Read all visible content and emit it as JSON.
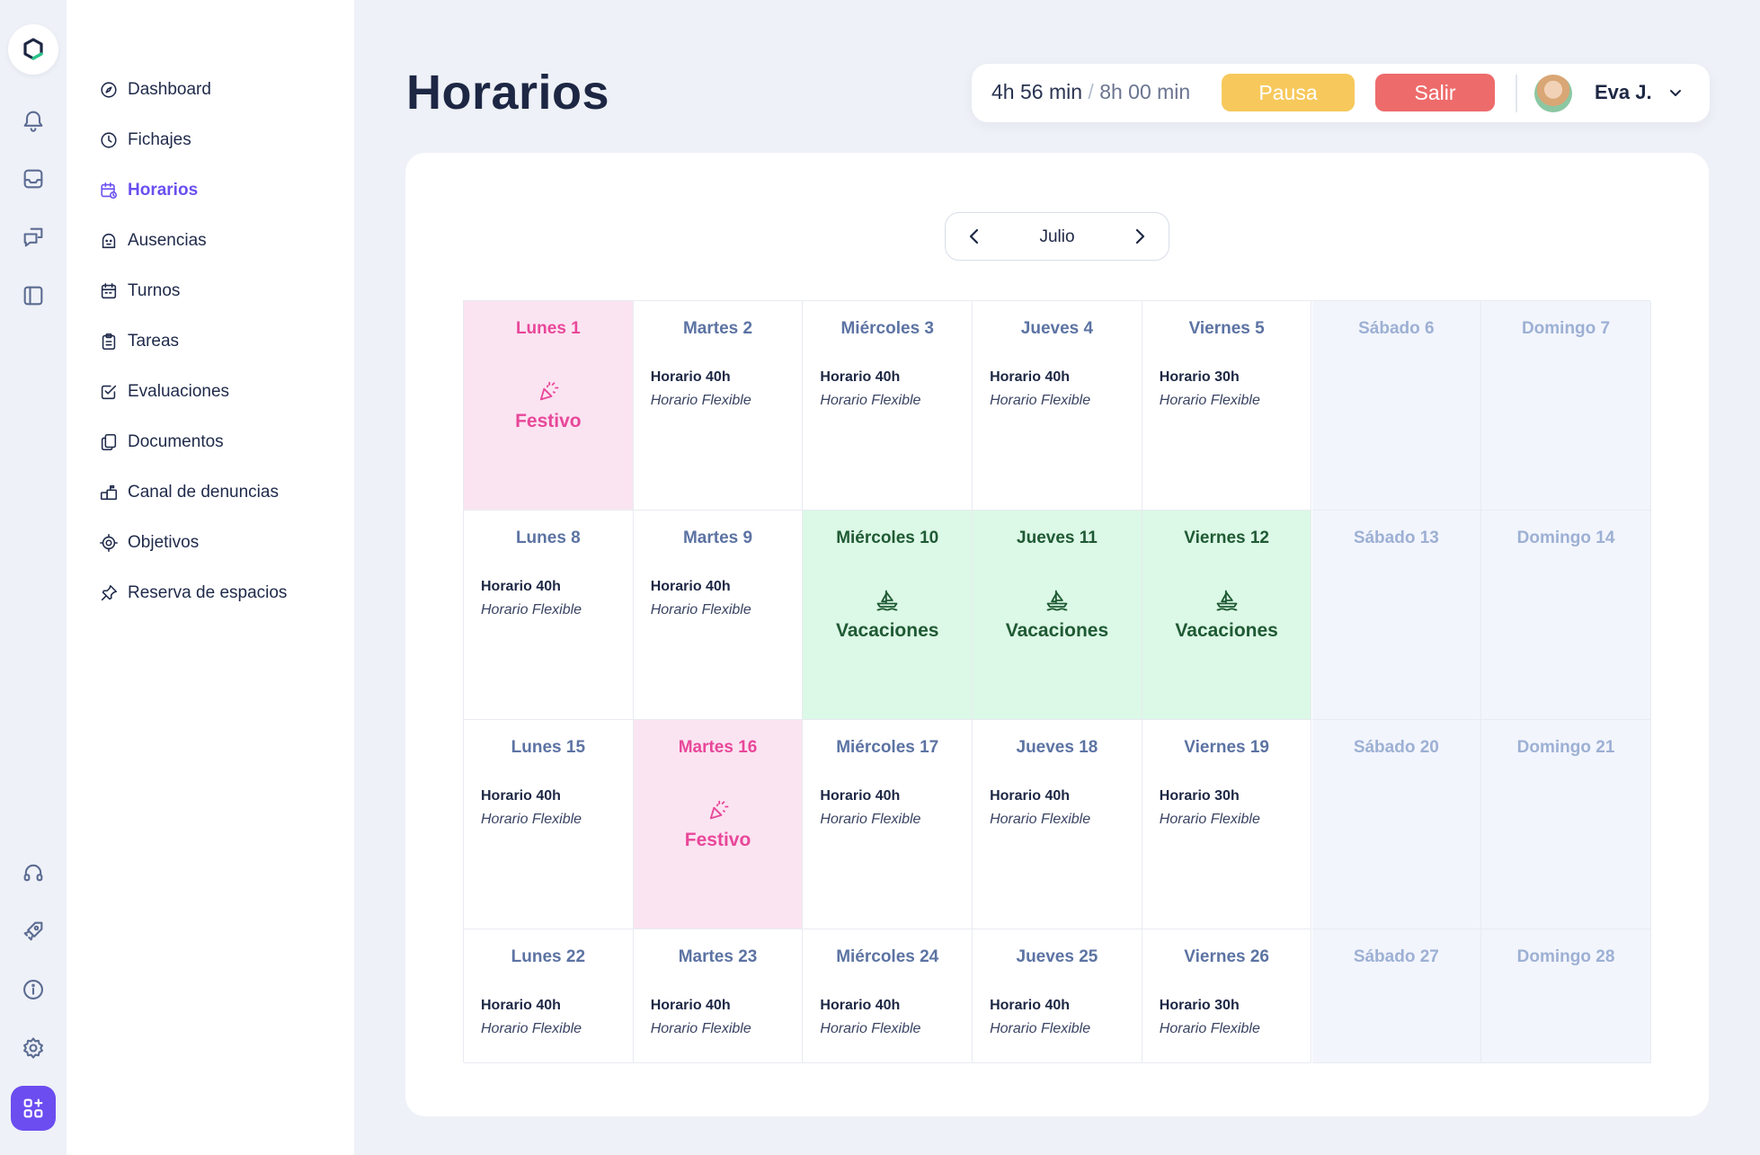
{
  "rail": {
    "icons": [
      "logo-icon",
      "bell-icon",
      "inbox-icon",
      "chat-icon",
      "sidebar-icon",
      "headset-icon",
      "rocket-icon",
      "info-icon",
      "gear-icon",
      "apps-grid-icon"
    ]
  },
  "sidebar": {
    "items": [
      {
        "label": "Dashboard",
        "icon": "compass-icon"
      },
      {
        "label": "Fichajes",
        "icon": "clock-icon"
      },
      {
        "label": "Horarios",
        "icon": "calendar-clock-icon",
        "active": true
      },
      {
        "label": "Ausencias",
        "icon": "face-icon"
      },
      {
        "label": "Turnos",
        "icon": "calendar-icon"
      },
      {
        "label": "Tareas",
        "icon": "clipboard-icon"
      },
      {
        "label": "Evaluaciones",
        "icon": "check-square-icon"
      },
      {
        "label": "Documentos",
        "icon": "documents-icon"
      },
      {
        "label": "Canal de denuncias",
        "icon": "mailbox-icon"
      },
      {
        "label": "Objetivos",
        "icon": "target-icon"
      },
      {
        "label": "Reserva de espacios",
        "icon": "pin-icon"
      }
    ]
  },
  "header": {
    "title": "Horarios",
    "timer": {
      "worked": "4h 56 min",
      "separator": "/",
      "total": "8h 00 min"
    },
    "pause_label": "Pausa",
    "exit_label": "Salir",
    "user_name": "Eva J."
  },
  "calendar": {
    "month": "Julio",
    "weeks": [
      [
        {
          "day": "Lunes 1",
          "kind": "holiday",
          "event": "Festivo"
        },
        {
          "day": "Martes 2",
          "kind": "work",
          "title": "Horario 40h",
          "type": "Horario Flexible"
        },
        {
          "day": "Miércoles 3",
          "kind": "work",
          "title": "Horario 40h",
          "type": "Horario Flexible"
        },
        {
          "day": "Jueves 4",
          "kind": "work",
          "title": "Horario 40h",
          "type": "Horario Flexible"
        },
        {
          "day": "Viernes 5",
          "kind": "work",
          "title": "Horario 30h",
          "type": "Horario Flexible"
        },
        {
          "day": "Sábado 6",
          "kind": "weekend"
        },
        {
          "day": "Domingo 7",
          "kind": "weekend"
        }
      ],
      [
        {
          "day": "Lunes 8",
          "kind": "work",
          "title": "Horario 40h",
          "type": "Horario Flexible"
        },
        {
          "day": "Martes 9",
          "kind": "work",
          "title": "Horario 40h",
          "type": "Horario Flexible"
        },
        {
          "day": "Miércoles 10",
          "kind": "vacation",
          "event": "Vacaciones"
        },
        {
          "day": "Jueves 11",
          "kind": "vacation",
          "event": "Vacaciones"
        },
        {
          "day": "Viernes 12",
          "kind": "vacation",
          "event": "Vacaciones"
        },
        {
          "day": "Sábado 13",
          "kind": "weekend"
        },
        {
          "day": "Domingo 14",
          "kind": "weekend"
        }
      ],
      [
        {
          "day": "Lunes 15",
          "kind": "work",
          "title": "Horario 40h",
          "type": "Horario Flexible"
        },
        {
          "day": "Martes 16",
          "kind": "holiday",
          "event": "Festivo"
        },
        {
          "day": "Miércoles 17",
          "kind": "work",
          "title": "Horario 40h",
          "type": "Horario Flexible"
        },
        {
          "day": "Jueves 18",
          "kind": "work",
          "title": "Horario 40h",
          "type": "Horario Flexible"
        },
        {
          "day": "Viernes 19",
          "kind": "work",
          "title": "Horario 30h",
          "type": "Horario Flexible"
        },
        {
          "day": "Sábado 20",
          "kind": "weekend"
        },
        {
          "day": "Domingo 21",
          "kind": "weekend"
        }
      ],
      [
        {
          "day": "Lunes 22",
          "kind": "work",
          "title": "Horario 40h",
          "type": "Horario Flexible"
        },
        {
          "day": "Martes 23",
          "kind": "work",
          "title": "Horario 40h",
          "type": "Horario Flexible"
        },
        {
          "day": "Miércoles 24",
          "kind": "work",
          "title": "Horario 40h",
          "type": "Horario Flexible"
        },
        {
          "day": "Jueves 25",
          "kind": "work",
          "title": "Horario 40h",
          "type": "Horario Flexible"
        },
        {
          "day": "Viernes 26",
          "kind": "work",
          "title": "Horario 30h",
          "type": "Horario Flexible"
        },
        {
          "day": "Sábado 27",
          "kind": "weekend"
        },
        {
          "day": "Domingo 28",
          "kind": "weekend"
        }
      ]
    ]
  },
  "colors": {
    "accent": "#6a4ff0",
    "pause": "#f7c95c",
    "exit": "#ee6b6b",
    "holiday_bg": "#fbe4f1",
    "holiday_text": "#e8479a",
    "vacation_bg": "#dcf8e6",
    "vacation_text": "#1f5a34",
    "weekend_bg": "#f2f5fc"
  }
}
